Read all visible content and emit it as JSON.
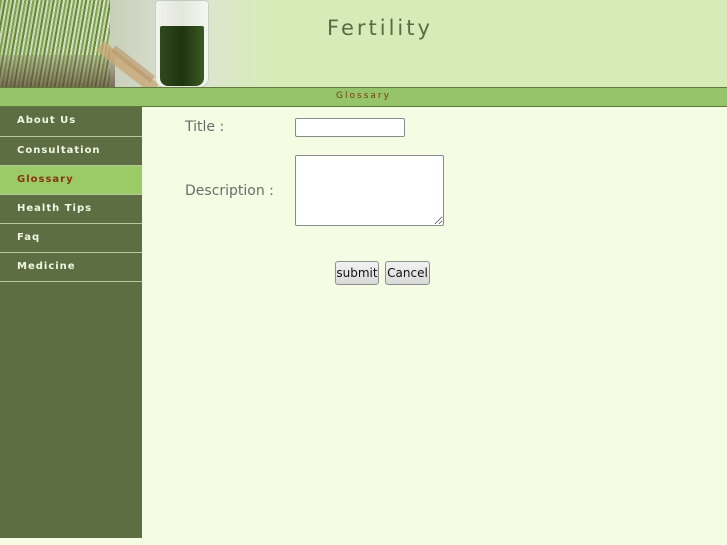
{
  "header": {
    "site_title": "Fertility"
  },
  "strip": {
    "current_page": "Glossary"
  },
  "sidebar": {
    "items": [
      {
        "label": "About Us"
      },
      {
        "label": "Consultation"
      },
      {
        "label": "Glossary",
        "active": true
      },
      {
        "label": "Health Tips"
      },
      {
        "label": "Faq"
      },
      {
        "label": "Medicine"
      }
    ]
  },
  "form": {
    "title_label": "Title :",
    "title_value": "",
    "description_label": "Description :",
    "description_value": "",
    "submit_label": "submit",
    "cancel_label": "Cancel"
  },
  "colors": {
    "sidebar_bg": "#5d6f42",
    "active_item_bg": "#9acb67",
    "active_item_text": "#8a3310",
    "strip_bg": "#95c46a",
    "header_bg": "#d6ebb8",
    "content_bg": "#f4fde4"
  }
}
